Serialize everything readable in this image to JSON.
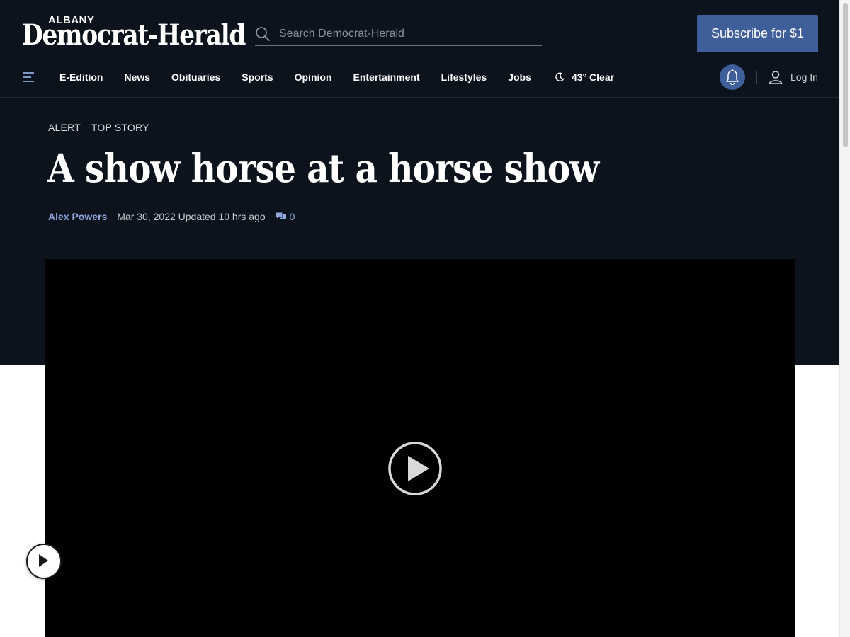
{
  "header": {
    "logo_city": "ALBANY",
    "logo_name": "Democrat-Herald",
    "search_placeholder": "Search Democrat-Herald",
    "subscribe_label": "Subscribe for $1"
  },
  "nav": {
    "items": [
      {
        "label": "E-Edition"
      },
      {
        "label": "News"
      },
      {
        "label": "Obituaries"
      },
      {
        "label": "Sports"
      },
      {
        "label": "Opinion"
      },
      {
        "label": "Entertainment"
      },
      {
        "label": "Lifestyles"
      },
      {
        "label": "Jobs"
      }
    ],
    "weather": "43° Clear",
    "login_label": "Log In"
  },
  "article": {
    "flags": [
      "ALERT",
      "TOP STORY"
    ],
    "headline": "A show horse at a horse show",
    "author": "Alex Powers",
    "date_text": "Mar 30, 2022 Updated 10 hrs ago",
    "comment_count": "0"
  },
  "icons": {
    "search": "search-icon",
    "menu": "hamburger-menu-icon",
    "weather": "moon-icon",
    "notifications": "bell-icon",
    "account": "user-icon",
    "comments": "comments-icon",
    "video_play": "play-icon"
  },
  "colors": {
    "header_bg": "#0d131d",
    "accent": "#3e5f9a",
    "link": "#8fa9de",
    "video_bg": "#000000"
  }
}
